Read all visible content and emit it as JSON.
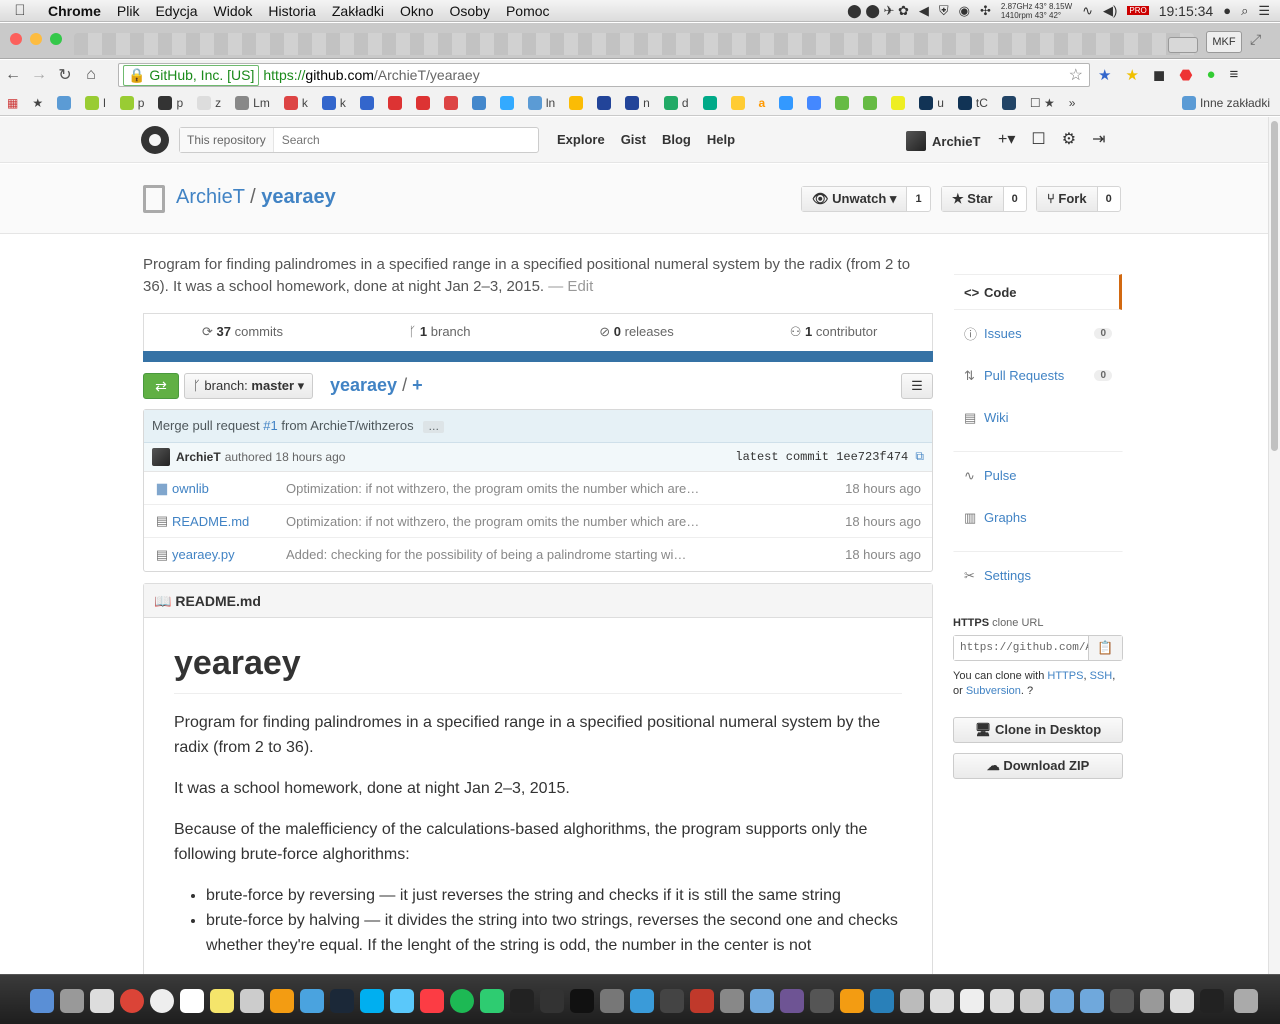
{
  "menubar": {
    "app": "Chrome",
    "items": [
      "Plik",
      "Edycja",
      "Widok",
      "Historia",
      "Zakładki",
      "Okno",
      "Osoby",
      "Pomoc"
    ],
    "stats_top": "2.87GHz  43°  8.15W",
    "stats_bottom": "1410rpm  43°  42°",
    "clock": "19:15:34"
  },
  "tabstrip": {
    "profile": "MKF"
  },
  "omnibox": {
    "ev_cert": "GitHub, Inc. [US]",
    "scheme": "https://",
    "host": "github.com",
    "path": "/ArchieT/yearaey"
  },
  "bookmarks": {
    "items": [
      "l",
      "p",
      "p",
      "z",
      "Lm",
      "k",
      "k",
      "ln",
      "n",
      "d",
      "u",
      "tC"
    ],
    "other": "Inne zakładki"
  },
  "header": {
    "search_scope": "This repository",
    "search_placeholder": "Search",
    "nav": [
      "Explore",
      "Gist",
      "Blog",
      "Help"
    ],
    "username": "ArchieT",
    "plus_icon": "+▾"
  },
  "repo": {
    "owner": "ArchieT",
    "separator": "/",
    "name": "yearaey",
    "watch_label": "Unwatch",
    "watch_count": "1",
    "star_label": "Star",
    "star_count": "0",
    "fork_label": "Fork",
    "fork_count": "0",
    "description": "Program for finding palindromes in a specified range in a specified positional numeral system by the radix (from 2 to 36). It was a school homework, done at night Jan 2–3, 2015.",
    "edit_label": "— Edit"
  },
  "stats": {
    "commits_num": "37",
    "commits_label": "commits",
    "branch_num": "1",
    "branch_label": "branch",
    "releases_num": "0",
    "releases_label": "releases",
    "contrib_num": "1",
    "contrib_label": "contributor",
    "language_color": "#3572a5"
  },
  "filenav": {
    "branch_prefix": "branch:",
    "branch_name": "master",
    "crumb_repo": "yearaey",
    "crumb_sep": "/",
    "crumb_plus": "+"
  },
  "commit": {
    "title_prefix": "Merge pull request",
    "pr": "#1",
    "title_suffix": "from ArchieT/withzeros",
    "ellipsis": "…",
    "author": "ArchieT",
    "authored": "authored 18 hours ago",
    "latest_label": "latest commit",
    "sha": "1ee723f474"
  },
  "files": [
    {
      "icon": "folder-icon",
      "name": "ownlib",
      "message": "Optimization: if not withzero, the program omits the number which are…",
      "age": "18 hours ago"
    },
    {
      "icon": "file-icon",
      "name": "README.md",
      "message": "Optimization: if not withzero, the program omits the number which are…",
      "age": "18 hours ago"
    },
    {
      "icon": "file-icon",
      "name": "yearaey.py",
      "message": "Added: checking for the possibility of being a palindrome starting wi…",
      "age": "18 hours ago"
    }
  ],
  "readme": {
    "header": "README.md",
    "h1": "yearaey",
    "p1": "Program for finding palindromes in a specified range in a specified positional numeral system by the radix (from 2 to 36).",
    "p2": "It was a school homework, done at night Jan 2–3, 2015.",
    "p3": "Because of the malefficiency of the calculations-based alghorithms, the program supports only the following brute-force alghorithms:",
    "li1": "brute-force by reversing — it just reverses the string and checks if it is still the same string",
    "li2": "brute-force by halving — it divides the string into two strings, reverses the second one and checks whether they're equal. If the lenght of the string is odd, the number in the center is not"
  },
  "sidebar": {
    "code": "Code",
    "issues": "Issues",
    "issues_count": "0",
    "pulls": "Pull Requests",
    "pulls_count": "0",
    "wiki": "Wiki",
    "pulse": "Pulse",
    "graphs": "Graphs",
    "settings": "Settings",
    "clone_proto": "HTTPS",
    "clone_label": "clone URL",
    "clone_url": "https://github.com/ArchieT/yearaey.git",
    "help_prefix": "You can clone with",
    "help_https": "HTTPS",
    "help_ssh": "SSH",
    "help_or": "or",
    "help_svn": "Subversion",
    "clone_desktop": "Clone in Desktop",
    "download_zip": "Download ZIP"
  }
}
